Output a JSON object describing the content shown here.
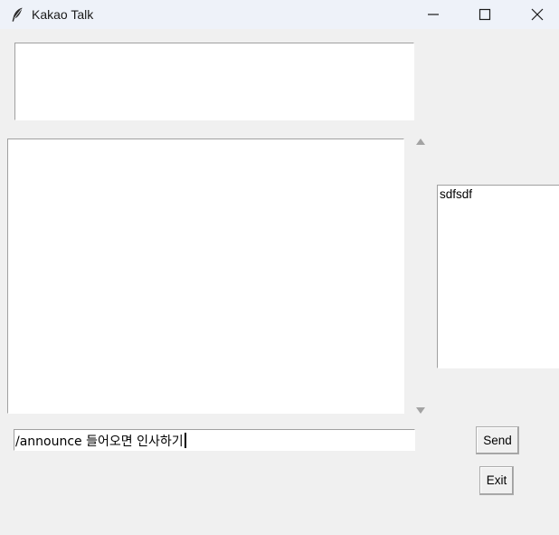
{
  "window": {
    "title": "Kakao Talk",
    "app_icon": "feather-icon",
    "controls": {
      "minimize_icon": "minimize-icon",
      "maximize_icon": "maximize-icon",
      "close_icon": "close-icon"
    }
  },
  "header_box": {
    "text": ""
  },
  "chat_area": {
    "text": ""
  },
  "user_list": {
    "items": [
      "sdfsdf"
    ]
  },
  "message_input": {
    "value": "/announce 들어오면 인사하기"
  },
  "buttons": {
    "send_label": "Send",
    "exit_label": "Exit"
  },
  "colors": {
    "background": "#f0f0f0",
    "titlebar": "#eef2f9",
    "field": "#ffffff",
    "border": "#a0a0a0"
  }
}
